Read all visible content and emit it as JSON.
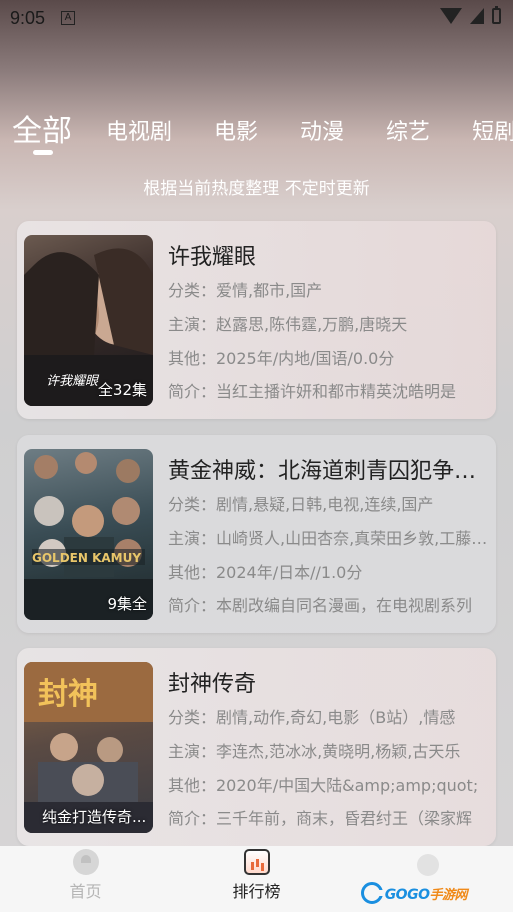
{
  "status": {
    "time": "9:05",
    "notif_icon": "a-icon"
  },
  "tabs": [
    "全部",
    "电视剧",
    "电影",
    "动漫",
    "综艺",
    "短剧"
  ],
  "subtitle": "根据当前热度整理 不定时更新",
  "cards": [
    {
      "title": "许我耀眼",
      "category": "分类：爱情,都市,国产",
      "cast": "主演：赵露思,陈伟霆,万鹏,唐晓天",
      "other": "其他：2025年/内地/国语/0.0分",
      "intro": "简介：当红主播许妍和都市精英沈皓明是",
      "badge": "全32集"
    },
    {
      "title": "黄金神威：北海道刺青囚犯争夺战",
      "category": "分类：剧情,悬疑,日韩,电视,连续,国产",
      "cast": "主演：山崎贤人,山田杏奈,真荣田乡敦,工藤阿须加",
      "other": "其他：2024年/日本//1.0分",
      "intro": "简介：本剧改编自同名漫画，在电视剧系列",
      "badge": "9集全"
    },
    {
      "title": "封神传奇",
      "category": "分类：剧情,动作,奇幻,电影（B站）,情感",
      "cast": "主演：李连杰,范冰冰,黄晓明,杨颖,古天乐",
      "other": "其他：2020年/中国大陆&amp;amp;quot;",
      "intro": "简介：三千年前，商末，昏君纣王（梁家辉",
      "badge": "纯金打造传奇..."
    }
  ],
  "bottom_nav": {
    "home": "首页",
    "ranking": "排行榜",
    "watermark_latin": "GOGO",
    "watermark_cn": "手游网"
  },
  "colors": {
    "accent": "#e86a3b",
    "watermark_blue": "#1a8fe0",
    "watermark_orange": "#f08a1a"
  }
}
